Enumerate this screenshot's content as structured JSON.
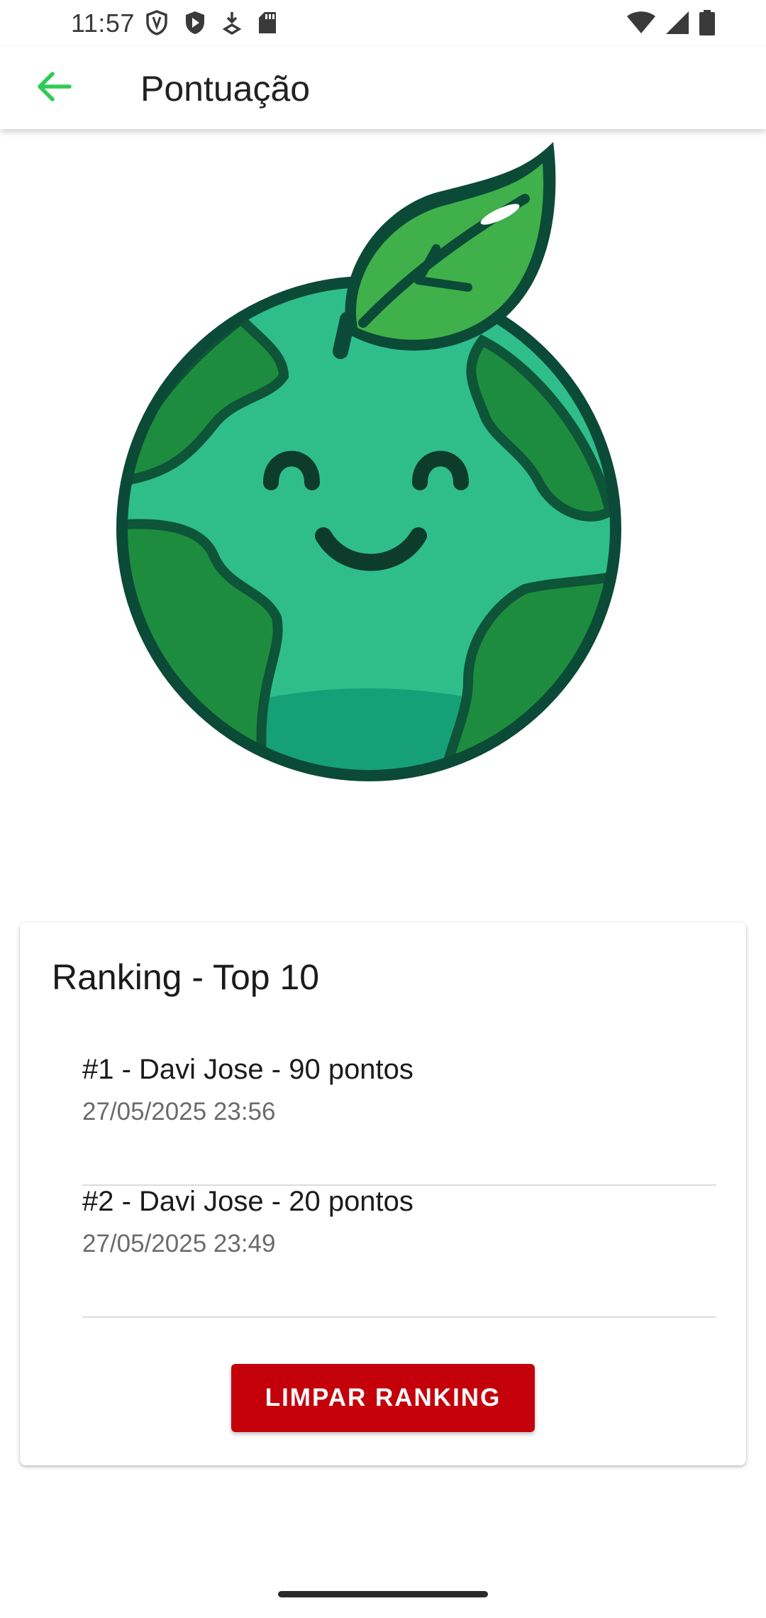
{
  "status_bar": {
    "time": "11:57",
    "left_icons": [
      "vpn-shield-icon",
      "play-protect-icon",
      "download-icon",
      "sd-card-icon"
    ],
    "right_icons": [
      "wifi-icon",
      "cell-signal-icon",
      "battery-icon"
    ]
  },
  "app_bar": {
    "title": "Pontuação",
    "back_icon": "arrow-left-icon",
    "accent_color": "#2ecc55"
  },
  "hero": {
    "image": "smiling-earth-leaf-mascot"
  },
  "ranking": {
    "title": "Ranking - Top 10",
    "entries": [
      {
        "title": "#1 - Davi Jose - 90 pontos",
        "date": "27/05/2025 23:56"
      },
      {
        "title": "#2 - Davi Jose - 20 pontos",
        "date": "27/05/2025 23:49"
      }
    ],
    "clear_button_label": "LIMPAR RANKING",
    "clear_button_color": "#c4000b"
  }
}
